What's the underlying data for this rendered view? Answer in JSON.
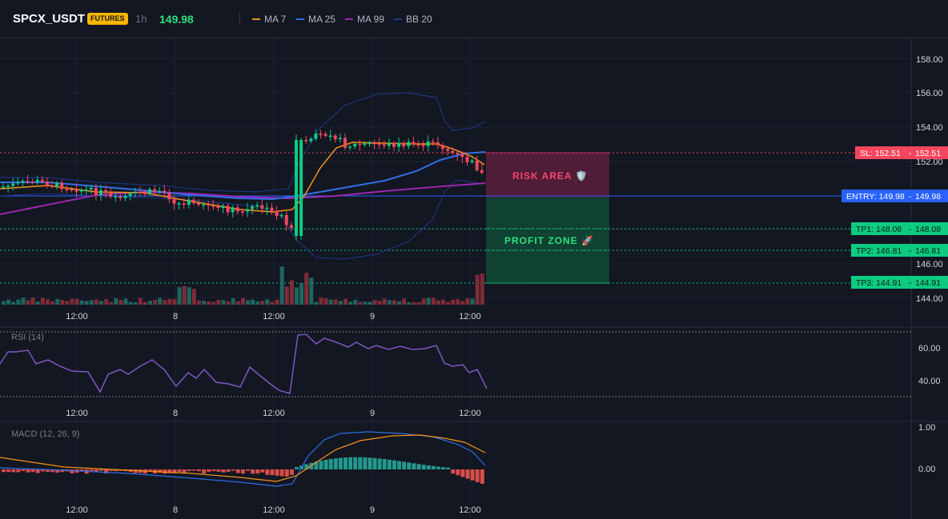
{
  "header": {
    "symbol": "SPCX_USDT",
    "badge": "FUTURES",
    "timeframe": "1h",
    "price": "149.98",
    "legend": [
      {
        "label": "MA 7",
        "color": "#f7931a"
      },
      {
        "label": "MA 25",
        "color": "#2f6fe8"
      },
      {
        "label": "MA 99",
        "color": "#9c27b0"
      },
      {
        "label": "BB 20",
        "color": "#1e3a8a"
      }
    ]
  },
  "colors": {
    "up": "#26a69a",
    "up_candle": "#0ecb81",
    "down": "#f6465d",
    "sl": "#f6465d",
    "entry": "#2962ff",
    "tp": "#0ecb81",
    "bg": "#131722"
  },
  "price_axis": {
    "ticks": [
      "158.00",
      "156.00",
      "154.00",
      "152.00",
      "146.00",
      "144.00"
    ]
  },
  "time_axis": {
    "labels": [
      "12:00",
      "8",
      "12:00",
      "9",
      "12:00"
    ]
  },
  "levels": {
    "sl": {
      "label": "SL: 152.51",
      "value": "152.51"
    },
    "entry": {
      "label": "ENTRY: 149.98",
      "value": "149.98"
    },
    "tp": [
      {
        "label": "TP1: 148.08",
        "value": "148.08"
      },
      {
        "label": "TP2: 146.81",
        "value": "146.81"
      },
      {
        "label": "TP3: 144.91",
        "value": "144.91"
      }
    ]
  },
  "zones": {
    "risk": "RISK AREA 🛡️",
    "profit": "PROFIT ZONE 🚀"
  },
  "rsi": {
    "title": "RSI (14)",
    "ticks": [
      "60.00",
      "40.00"
    ]
  },
  "macd": {
    "title": "MACD (12, 26, 9)",
    "ticks": [
      "1.00",
      "0.00"
    ]
  }
}
